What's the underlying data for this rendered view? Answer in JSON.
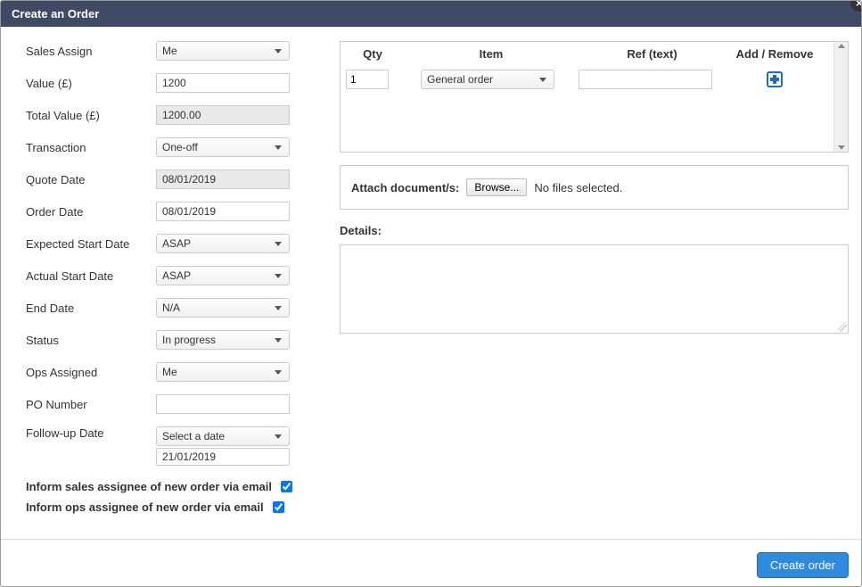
{
  "dialog": {
    "title": "Create an Order"
  },
  "form": {
    "sales_assign": {
      "label": "Sales Assign",
      "value": "Me"
    },
    "value": {
      "label": "Value (£)",
      "value": "1200"
    },
    "total_value": {
      "label": "Total Value (£)",
      "value": "1200.00"
    },
    "transaction": {
      "label": "Transaction",
      "value": "One-off"
    },
    "quote_date": {
      "label": "Quote Date",
      "value": "08/01/2019"
    },
    "order_date": {
      "label": "Order Date",
      "value": "08/01/2019"
    },
    "expected_start": {
      "label": "Expected Start Date",
      "value": "ASAP"
    },
    "actual_start": {
      "label": "Actual Start Date",
      "value": "ASAP"
    },
    "end_date": {
      "label": "End Date",
      "value": "N/A"
    },
    "status": {
      "label": "Status",
      "value": "In progress"
    },
    "ops_assigned": {
      "label": "Ops Assigned",
      "value": "Me"
    },
    "po_number": {
      "label": "PO Number",
      "value": ""
    },
    "followup": {
      "label": "Follow-up Date",
      "value": "Select a date",
      "extra": "21/01/2019"
    },
    "inform_sales": {
      "label": "Inform sales assignee of new order via email",
      "checked": true
    },
    "inform_ops": {
      "label": "Inform ops assignee of new order via email",
      "checked": true
    }
  },
  "grid": {
    "headers": {
      "qty": "Qty",
      "item": "Item",
      "ref": "Ref (text)",
      "addrem": "Add / Remove"
    },
    "rows": [
      {
        "qty": "1",
        "item": "General order",
        "ref": ""
      }
    ]
  },
  "attach": {
    "label": "Attach document/s:",
    "browse": "Browse...",
    "status": "No files selected."
  },
  "details": {
    "label": "Details:",
    "value": ""
  },
  "buttons": {
    "create": "Create order"
  }
}
